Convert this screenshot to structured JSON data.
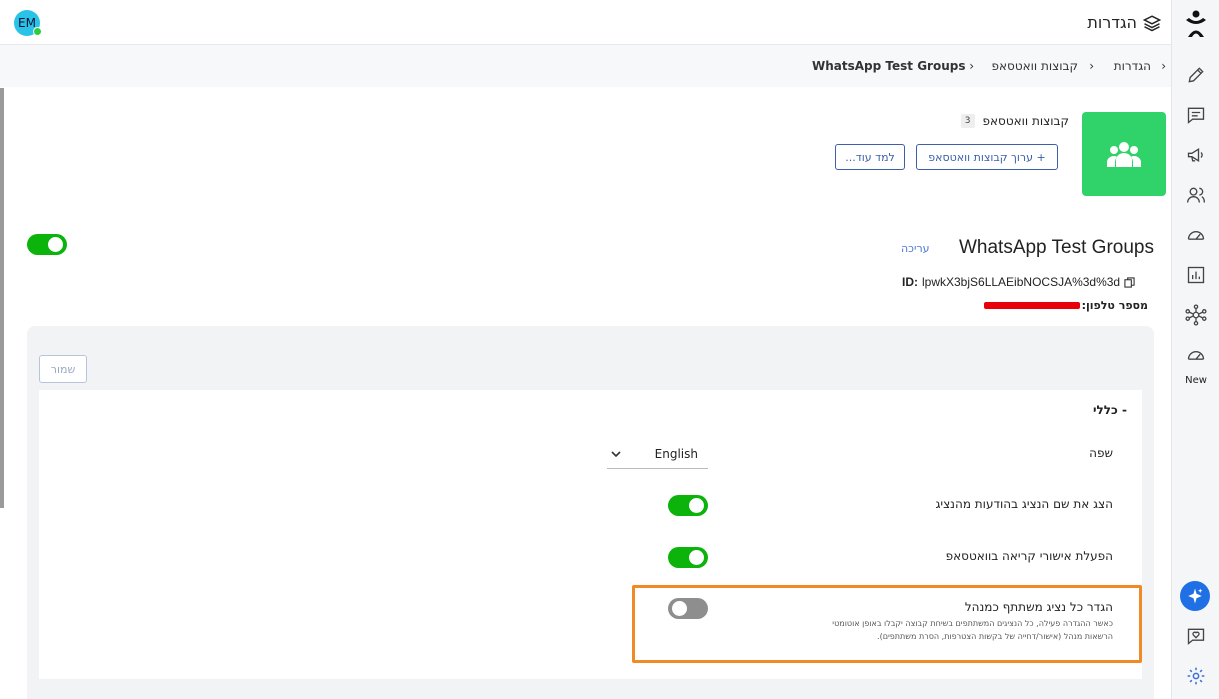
{
  "header": {
    "title": "הגדרות",
    "avatar_initials": "EM"
  },
  "breadcrumb": {
    "items": [
      "הגדרות",
      "קבוצות וואטסאפ",
      "WhatsApp Test Groups"
    ]
  },
  "card": {
    "title": "קבוצות וואטסאפ",
    "count": "3",
    "edit_button": "+ ערוך קבוצות וואטסאפ",
    "learn_button": "למד עוד..."
  },
  "group": {
    "name": "WhatsApp Test Groups",
    "edit_link": "עריכה",
    "id_label": "ID:",
    "id_value": "lpwkX3bjS6LLAEibNOCSJA%3d%3d",
    "phone_label": "מספר טלפון:",
    "enabled": true
  },
  "form": {
    "save_label": "שמור",
    "section_title": "- כללי",
    "language_label": "שפה",
    "language_value": "English",
    "rows": [
      {
        "label": "הצג את שם הנציג בהודעות מהנציג",
        "on": true
      },
      {
        "label": "הפעלת אישורי קריאה בוואטסאפ",
        "on": true
      },
      {
        "label": "הגדר כל נציג משתתף כמנהל",
        "on": false,
        "description": "כאשר ההגדרה פעילה, כל הנציגים המשתתפים בשיחת קבוצה יקבלו באופן אוטומטי הרשאות מנהל (אישור/דחייה של בקשות הצטרפות, הסרת משתתפים)."
      }
    ]
  },
  "sidebar": {
    "new_badge": "New",
    "icons": [
      "logo-icon",
      "pencil-icon",
      "chat-icon",
      "megaphone-icon",
      "users-icon",
      "gauge-icon",
      "chart-icon",
      "network-icon",
      "gauge-new-icon",
      "sparkle-icon",
      "heart-chat-icon",
      "gear-icon"
    ]
  },
  "colors": {
    "accent_green": "#2fd36a",
    "toggle_on": "#0bb30b",
    "highlight_orange": "#f08a24",
    "link_blue": "#3d5fa8"
  }
}
